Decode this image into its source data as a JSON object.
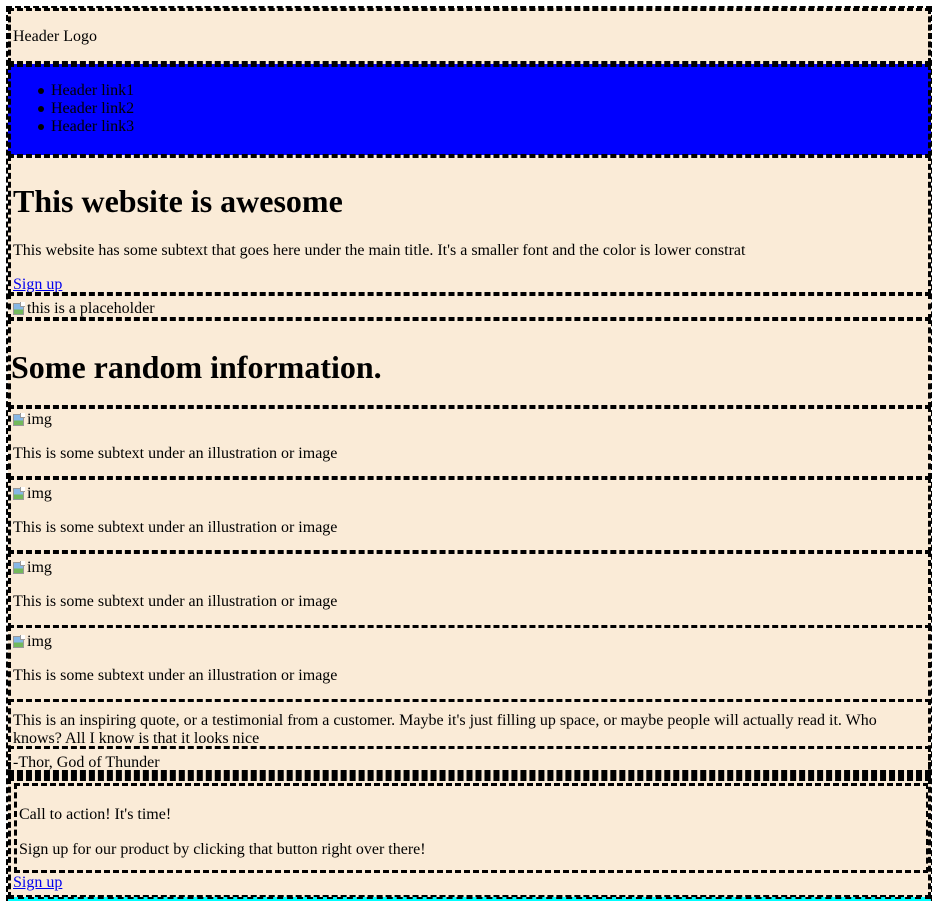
{
  "header": {
    "logo": "Header Logo",
    "links": [
      "Header link1",
      "Header link2",
      "Header link3"
    ],
    "nav_background": "#0000ff"
  },
  "hero": {
    "title": "This website is awesome",
    "subtext": "This website has some subtext that goes here under the main title. It's a smaller font and the color is lower constrat",
    "signup_label": "Sign up",
    "image_alt": "this is a placeholder"
  },
  "info": {
    "title": "Some random information.",
    "items": [
      {
        "image_alt": "img",
        "caption": "This is some subtext under an illustration or image"
      },
      {
        "image_alt": "img",
        "caption": "This is some subtext under an illustration or image"
      },
      {
        "image_alt": "img",
        "caption": "This is some subtext under an illustration or image"
      },
      {
        "image_alt": "img",
        "caption": "This is some subtext under an illustration or image"
      }
    ]
  },
  "quote": {
    "text": "This is an inspiring quote, or a testimonial from a customer. Maybe it's just filling up space, or maybe people will actually read it. Who knows? All I know is that it looks nice",
    "author": "-Thor, God of Thunder"
  },
  "cta": {
    "title": "Call to action! It's time!",
    "subtext": "Sign up for our product by clicking that button right over there!",
    "signup_label": "Sign up"
  },
  "colors": {
    "section_background": "#faebd7",
    "nav_background": "#0000ff",
    "link": "#0000ee",
    "bottom_strip": "#00ffff"
  }
}
